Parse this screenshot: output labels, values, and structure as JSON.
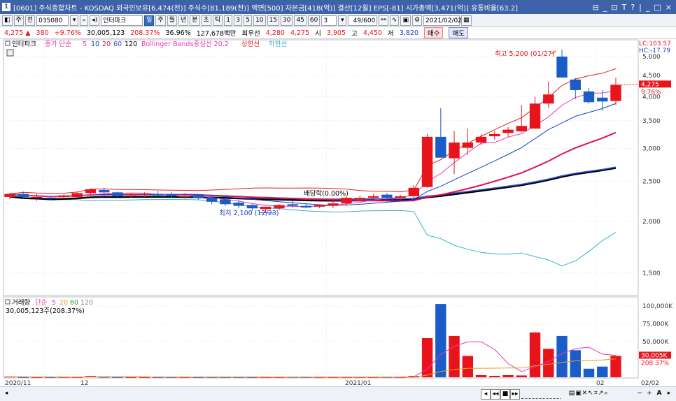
{
  "window": {
    "title": "[0601] 주식종합차트 - KOSDAQ 외국인보유[6,474(천)] 주식수[81,189(천)] 액면[500] 자본금[418(억)] 결산[12월] EPS[-81] 시가총액[3,471(억)] 유통비율[63.2]",
    "icon_label": "1",
    "controls": [
      "⊟",
      "_",
      "⊡",
      "T",
      "?",
      "|",
      "_",
      "□",
      "×"
    ]
  },
  "toolbar": {
    "mode_label": "주",
    "prev_label": "전",
    "code_value": "035080",
    "stock_name": "인터파크",
    "period_buttons": [
      "일",
      "주",
      "월",
      "년",
      "분",
      "초",
      "틱"
    ],
    "active_period": "일",
    "interval_buttons": [
      "1",
      "3",
      "5",
      "10",
      "15",
      "30",
      "45",
      "60"
    ],
    "interval_value": "3",
    "page_count": "49/600",
    "date_value": "2021/02/02"
  },
  "quote": {
    "price": "4,275",
    "change": "380",
    "change_pct": "+9.76%",
    "volume": "30,005,123",
    "volume_ratio": "208.37%",
    "turnover": "36.96%",
    "amount": "127,678백만",
    "priority_label": "최우선",
    "priority_ask": "4,280",
    "priority_bid": "4,275",
    "open_label": "시",
    "open": "3,905",
    "high_label": "고",
    "high": "4,450",
    "low_label": "저",
    "low": "3,820",
    "buy_label": "매수",
    "sell_label": "매도"
  },
  "legend": {
    "name": "인터파크",
    "ma_label": "종가 단순",
    "ma_periods": [
      "5",
      "10",
      "20",
      "60",
      "120"
    ],
    "bollinger": "Bollinger Bands중심선 20,2",
    "upper": "상한선",
    "lower": "하한선"
  },
  "volume_legend": {
    "label": "거래량",
    "ma_label": "단순",
    "ma_periods": [
      "5",
      "20",
      "60",
      "120"
    ],
    "value": "30,005,123주(208.37%)"
  },
  "price_axis": {
    "ticks": [
      "5,000",
      "4,500",
      "4,000",
      "3,500",
      "3,000",
      "2,500",
      "2,000",
      "1,500"
    ],
    "lc": "LC:103.57",
    "hc": "HC:-17.79",
    "current": "4,275",
    "current_pct": "9.76%"
  },
  "volume_axis": {
    "ticks": [
      "100,000K",
      "75,000K",
      "50,000K"
    ],
    "current": "30,005K",
    "current_pct": "208.37%"
  },
  "date_axis": {
    "labels": [
      "2020/11",
      "12",
      "2021/01",
      "02",
      "02/02"
    ]
  },
  "annotations": {
    "high": "최고 5,200 (01/27)",
    "low": "최저 2,100 (12/23)",
    "dividend": "배당락(0.00%)"
  },
  "colors": {
    "up": "#e8141c",
    "down": "#1a5cc8",
    "ma5": "#e838b8",
    "ma10": "#1040d0",
    "ma20": "#e01050",
    "ma60": "#2850d0",
    "ma120": "#000000",
    "bb_upper": "#e02020",
    "bb_lower": "#30b0d0"
  },
  "chart_data": {
    "type": "candlestick",
    "dates": [
      "11/26",
      "11/27",
      "11/30",
      "12/01",
      "12/02",
      "12/03",
      "12/04",
      "12/07",
      "12/08",
      "12/09",
      "12/10",
      "12/11",
      "12/14",
      "12/15",
      "12/16",
      "12/17",
      "12/18",
      "12/21",
      "12/22",
      "12/23",
      "12/24",
      "12/28",
      "12/29",
      "12/30",
      "01/04",
      "01/05",
      "01/06",
      "01/07",
      "01/08",
      "01/11",
      "01/12",
      "01/13",
      "01/14",
      "01/15",
      "01/18",
      "01/19",
      "01/20",
      "01/21",
      "01/22",
      "01/25",
      "01/26",
      "01/27",
      "01/28",
      "01/29",
      "02/01",
      "02/02"
    ],
    "open": [
      2290,
      2330,
      2280,
      2280,
      2290,
      2290,
      2340,
      2380,
      2350,
      2310,
      2320,
      2330,
      2320,
      2300,
      2310,
      2280,
      2260,
      2220,
      2190,
      2140,
      2150,
      2200,
      2180,
      2170,
      2180,
      2210,
      2260,
      2280,
      2320,
      2280,
      2300,
      2420,
      3200,
      2840,
      3010,
      3100,
      3210,
      3270,
      3300,
      3350,
      3850,
      5000,
      4400,
      4120,
      3980,
      3905
    ],
    "high": [
      2340,
      2360,
      2330,
      2300,
      2320,
      2350,
      2400,
      2410,
      2360,
      2340,
      2350,
      2370,
      2350,
      2340,
      2320,
      2300,
      2290,
      2250,
      2200,
      2160,
      2200,
      2240,
      2210,
      2200,
      2260,
      2290,
      2310,
      2330,
      2340,
      2320,
      2450,
      3260,
      3750,
      3300,
      3350,
      3250,
      3300,
      3380,
      3820,
      4000,
      4350,
      5200,
      4440,
      4200,
      4150,
      4450
    ],
    "low": [
      2260,
      2270,
      2240,
      2250,
      2260,
      2270,
      2320,
      2340,
      2290,
      2280,
      2290,
      2300,
      2280,
      2270,
      2260,
      2200,
      2180,
      2150,
      2120,
      2100,
      2130,
      2160,
      2150,
      2150,
      2150,
      2180,
      2240,
      2270,
      2230,
      2250,
      2280,
      2410,
      2960,
      2600,
      2900,
      3050,
      3150,
      3200,
      3280,
      3350,
      3750,
      4500,
      3950,
      3850,
      3700,
      3820
    ],
    "close": [
      2330,
      2290,
      2290,
      2270,
      2310,
      2340,
      2390,
      2350,
      2300,
      2330,
      2330,
      2310,
      2300,
      2300,
      2280,
      2230,
      2200,
      2180,
      2150,
      2170,
      2190,
      2180,
      2160,
      2190,
      2210,
      2280,
      2280,
      2300,
      2280,
      2300,
      2410,
      3200,
      2850,
      3100,
      3100,
      3200,
      3250,
      3330,
      3400,
      3850,
      4050,
      4450,
      4150,
      3880,
      3895,
      4275
    ],
    "volume": [
      800,
      300,
      200,
      200,
      300,
      300,
      2000,
      500,
      300,
      200,
      200,
      200,
      200,
      200,
      100,
      200,
      200,
      200,
      100,
      100,
      100,
      300,
      200,
      200,
      200,
      200,
      200,
      200,
      300,
      200,
      2000,
      55000,
      103000,
      58000,
      30000,
      3000,
      2000,
      3000,
      2500,
      63000,
      40000,
      58000,
      38000,
      12000,
      15000,
      30005
    ],
    "ylim": [
      1350,
      5300
    ],
    "volume_ylim": [
      0,
      108000
    ],
    "ytick_labels": [
      "5,000",
      "4,500",
      "4,000",
      "3,500",
      "3,000",
      "2,500",
      "2,000",
      "1,500"
    ]
  }
}
